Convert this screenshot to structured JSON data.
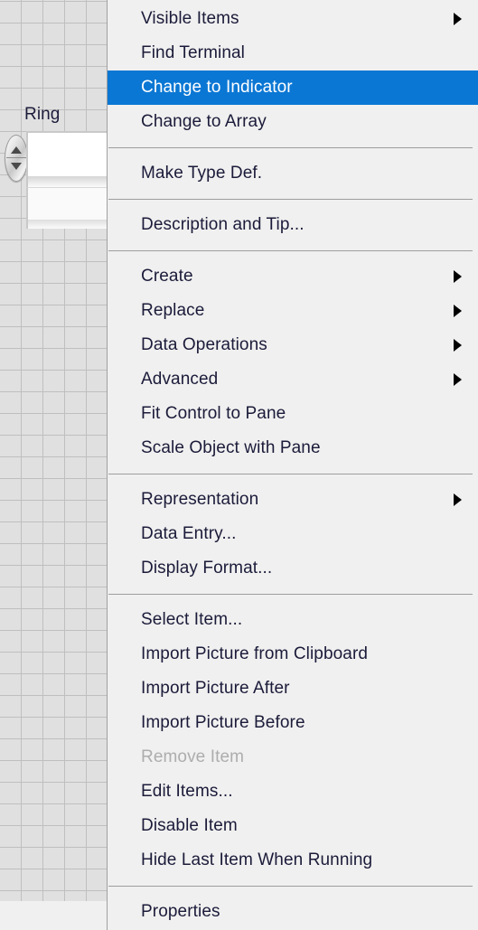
{
  "panel": {
    "control": {
      "label": "Ring",
      "type": "ring-control",
      "value": "",
      "spinner_increment_icon": "triangle-up-icon",
      "spinner_decrement_icon": "triangle-down-icon"
    },
    "background": "#e0e0e0",
    "grid_line_color": "#bfbfbf"
  },
  "context_menu": {
    "background": "#f0f0f0",
    "highlight_color": "#0b77d4",
    "text_color": "#1b1b3a",
    "disabled_text_color": "#adadad",
    "submenu_arrow_icon": "triangle-right-icon",
    "sections": [
      {
        "items": [
          {
            "label": "Visible Items",
            "submenu": true,
            "selected": false,
            "disabled": false
          },
          {
            "label": "Find Terminal",
            "submenu": false,
            "selected": false,
            "disabled": false
          },
          {
            "label": "Change to Indicator",
            "submenu": false,
            "selected": true,
            "disabled": false
          },
          {
            "label": "Change to Array",
            "submenu": false,
            "selected": false,
            "disabled": false
          }
        ]
      },
      {
        "items": [
          {
            "label": "Make Type Def.",
            "submenu": false,
            "selected": false,
            "disabled": false
          }
        ]
      },
      {
        "items": [
          {
            "label": "Description and Tip...",
            "submenu": false,
            "selected": false,
            "disabled": false
          }
        ]
      },
      {
        "items": [
          {
            "label": "Create",
            "submenu": true,
            "selected": false,
            "disabled": false
          },
          {
            "label": "Replace",
            "submenu": true,
            "selected": false,
            "disabled": false
          },
          {
            "label": "Data Operations",
            "submenu": true,
            "selected": false,
            "disabled": false
          },
          {
            "label": "Advanced",
            "submenu": true,
            "selected": false,
            "disabled": false
          },
          {
            "label": "Fit Control to Pane",
            "submenu": false,
            "selected": false,
            "disabled": false
          },
          {
            "label": "Scale Object with Pane",
            "submenu": false,
            "selected": false,
            "disabled": false
          }
        ]
      },
      {
        "items": [
          {
            "label": "Representation",
            "submenu": true,
            "selected": false,
            "disabled": false
          },
          {
            "label": "Data Entry...",
            "submenu": false,
            "selected": false,
            "disabled": false
          },
          {
            "label": "Display Format...",
            "submenu": false,
            "selected": false,
            "disabled": false
          }
        ]
      },
      {
        "items": [
          {
            "label": "Select Item...",
            "submenu": false,
            "selected": false,
            "disabled": false
          },
          {
            "label": "Import Picture from Clipboard",
            "submenu": false,
            "selected": false,
            "disabled": false
          },
          {
            "label": "Import Picture After",
            "submenu": false,
            "selected": false,
            "disabled": false
          },
          {
            "label": "Import Picture Before",
            "submenu": false,
            "selected": false,
            "disabled": false
          },
          {
            "label": "Remove Item",
            "submenu": false,
            "selected": false,
            "disabled": true
          },
          {
            "label": "Edit Items...",
            "submenu": false,
            "selected": false,
            "disabled": false
          },
          {
            "label": "Disable Item",
            "submenu": false,
            "selected": false,
            "disabled": false
          },
          {
            "label": "Hide Last Item When Running",
            "submenu": false,
            "selected": false,
            "disabled": false
          }
        ]
      },
      {
        "items": [
          {
            "label": "Properties",
            "submenu": false,
            "selected": false,
            "disabled": false
          }
        ]
      }
    ]
  }
}
